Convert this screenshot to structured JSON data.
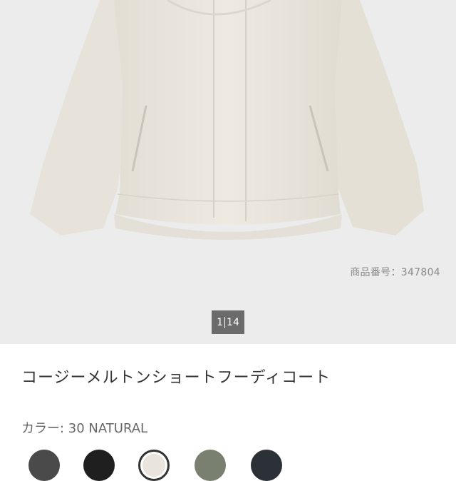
{
  "product": {
    "code_text": "商品番号：347804",
    "pager": {
      "current": "1",
      "total": "14"
    },
    "name": "コージーメルトンショートフーディコート",
    "color_text": "カラー: 30 NATURAL"
  },
  "colors": {
    "background": "#ececec",
    "coat": "#e9e5dc"
  },
  "swatches": [
    {
      "name": "dark-gray",
      "color": "#4a4a4a",
      "selected": false
    },
    {
      "name": "black",
      "color": "#1f1f1f",
      "selected": false
    },
    {
      "name": "natural",
      "color": "#e9e5dc",
      "selected": true
    },
    {
      "name": "olive",
      "color": "#7a8070",
      "selected": false
    },
    {
      "name": "navy",
      "color": "#2c3138",
      "selected": false
    }
  ]
}
